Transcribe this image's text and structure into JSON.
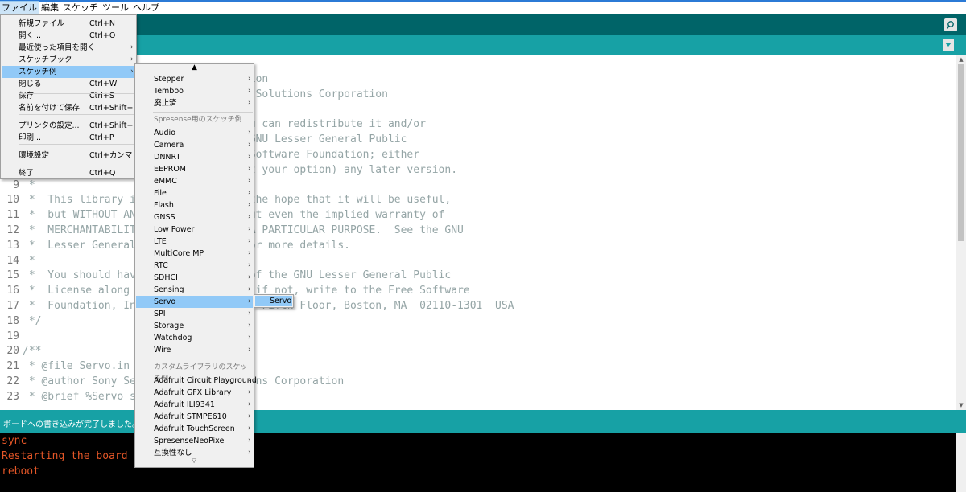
{
  "menubar": [
    "ファイル",
    "編集",
    "スケッチ",
    "ツール",
    "ヘルプ"
  ],
  "icons": {
    "serial_monitor": "magnifier-icon",
    "tab_menu": "chevron-down-icon",
    "submenu": "chevron-right-icon"
  },
  "file_menu": [
    {
      "label": "新規ファイル",
      "shortcut": "Ctrl+N"
    },
    {
      "label": "開く...",
      "shortcut": "Ctrl+O"
    },
    {
      "label": "最近使った項目を開く",
      "shortcut": "",
      "arrow": "›"
    },
    {
      "label": "スケッチブック",
      "shortcut": "",
      "arrow": "›"
    },
    {
      "label": "スケッチ例",
      "shortcut": "",
      "arrow": "›"
    },
    {
      "label": "閉じる",
      "shortcut": "Ctrl+W"
    },
    {
      "label": "保存",
      "shortcut": "Ctrl+S"
    },
    {
      "label": "名前を付けて保存",
      "shortcut": "Ctrl+Shift+S"
    },
    {
      "label": "プリンタの設定...",
      "shortcut": "Ctrl+Shift+P"
    },
    {
      "label": "印刷...",
      "shortcut": "Ctrl+P"
    },
    {
      "label": "環境設定",
      "shortcut": "Ctrl+カンマ"
    },
    {
      "label": "終了",
      "shortcut": "Ctrl+Q"
    }
  ],
  "examples_menu": {
    "scroll_up": "▲",
    "scroll_down": "▽",
    "builtin": [
      "Stepper",
      "Temboo",
      "廃止済"
    ],
    "spresense_header": "Spresense用のスケッチ例",
    "spresense": [
      "Audio",
      "Camera",
      "DNNRT",
      "EEPROM",
      "eMMC",
      "File",
      "Flash",
      "GNSS",
      "Low Power",
      "LTE",
      "MultiCore MP",
      "RTC",
      "SDHCI",
      "Sensing",
      "Servo",
      "SPI",
      "Storage",
      "Watchdog",
      "Wire"
    ],
    "custom_header": "カスタムライブラリのスケッチ例",
    "custom": [
      "Adafruit Circuit Playground",
      "Adafruit GFX Library",
      "Adafruit ILI9341",
      "Adafruit STMPE610",
      "Adafruit TouchScreen",
      "SpresenseNeoPixel",
      "互換性なし"
    ]
  },
  "servo_menu": [
    "Servo"
  ],
  "code_lines": [
    {
      "n": "",
      "t": "                                  ation"
    },
    {
      "n": "",
      "t": "                                  or Solutions Corporation"
    },
    {
      "n": "",
      "t": ""
    },
    {
      "n": "",
      "t": "                                  you can redistribute it and/or"
    },
    {
      "n": "",
      "t": "                                  e GNU Lesser General Public"
    },
    {
      "n": "",
      "t": "                                  e Software Foundation; either"
    },
    {
      "n": "",
      "t": "                                  (at your option) any later version."
    },
    {
      "n": "9",
      "t": " *"
    },
    {
      "n": "10",
      "t": " *  This library i                  the hope that it will be useful,"
    },
    {
      "n": "11",
      "t": " *  but WITHOUT AN                  ut even the implied warranty of"
    },
    {
      "n": "12",
      "t": " *  MERCHANTABILIT                  A PARTICULAR PURPOSE.  See the GNU"
    },
    {
      "n": "13",
      "t": " *  Lesser General                  or more details."
    },
    {
      "n": "14",
      "t": " *"
    },
    {
      "n": "15",
      "t": " *  You should hav                  of the GNU Lesser General Public"
    },
    {
      "n": "16",
      "t": " *  License along                  ; if not, write to the Free Software"
    },
    {
      "n": "17",
      "t": " *  Foundation, In                  , Fifth Floor, Boston, MA  02110-1301  USA"
    },
    {
      "n": "18",
      "t": " */"
    },
    {
      "n": "19",
      "t": ""
    },
    {
      "n": "20",
      "t": "/**"
    },
    {
      "n": "21",
      "t": " * @file Servo.in"
    },
    {
      "n": "22",
      "t": " * @author Sony Se                  ons Corporation"
    },
    {
      "n": "23",
      "t": " * @brief %Servo s"
    }
  ],
  "status_text": "ボードへの書き込みが完了しました。",
  "console_lines": [
    "sync",
    "Restarting the board",
    "reboot"
  ]
}
